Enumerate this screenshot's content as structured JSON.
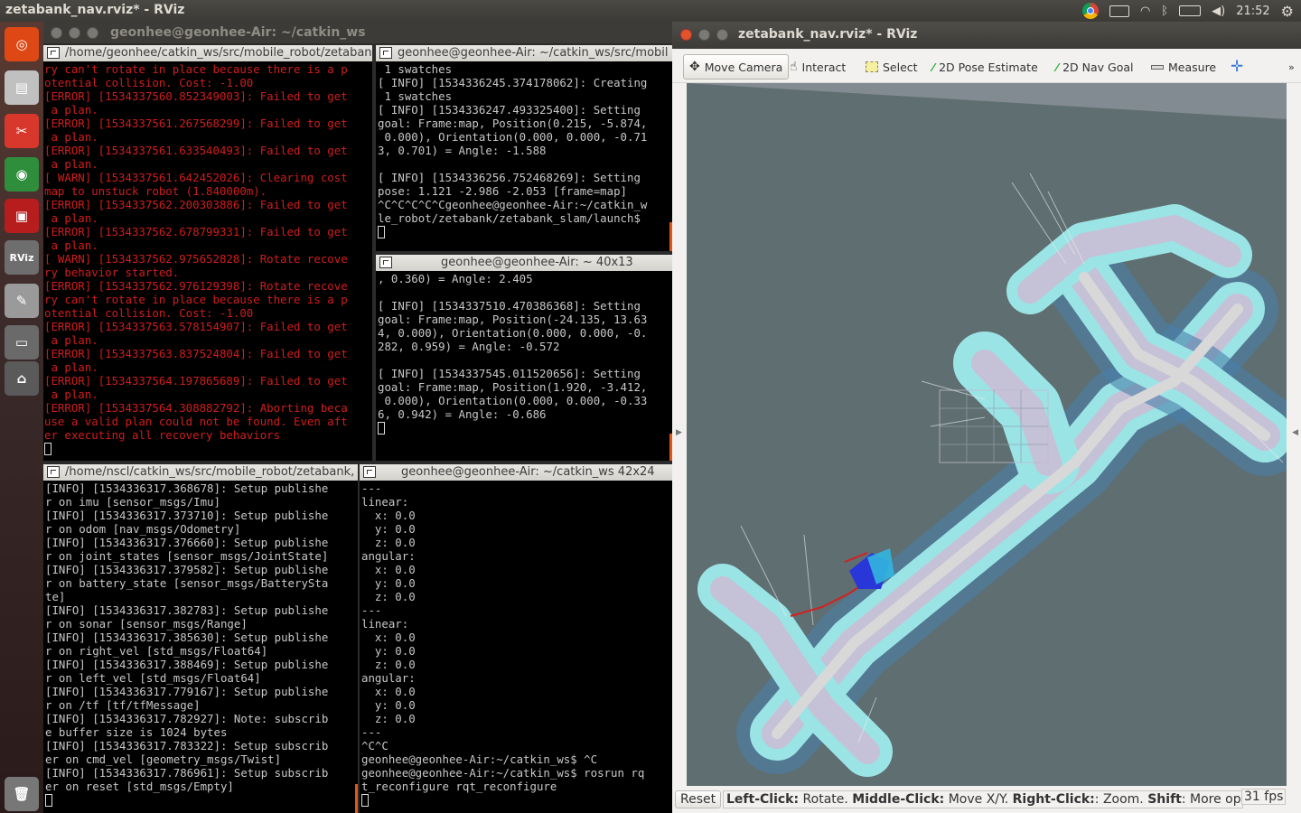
{
  "topbar": {
    "title": "zetabank_nav.rviz* - RViz",
    "clock": "21:52"
  },
  "launcher": {
    "items": [
      {
        "name": "ubuntu-dash-icon",
        "glyph": "◎",
        "bg": "#dd4814"
      },
      {
        "name": "files-icon",
        "glyph": "▤",
        "bg": "#c0c0c0"
      },
      {
        "name": "system-settings-icon",
        "glyph": "✂",
        "bg": "#d8382b"
      },
      {
        "name": "chrome-icon",
        "glyph": "◉",
        "bg": "#2f8e3c"
      },
      {
        "name": "terminal-icon",
        "glyph": "▣",
        "bg": "#b81d1d"
      },
      {
        "name": "rviz-icon",
        "glyph": "RViz",
        "bg": "#6e6e6e"
      },
      {
        "name": "text-editor-icon",
        "glyph": "✎",
        "bg": "#9a9a9a"
      },
      {
        "name": "disk-icon",
        "glyph": "▭",
        "bg": "#6a6a6a"
      },
      {
        "name": "usb-icon",
        "glyph": "⌂",
        "bg": "#5a5a5a"
      },
      {
        "name": "trash-icon",
        "glyph": "🗑",
        "bg": "#777"
      }
    ]
  },
  "main_window": {
    "title": "geonhee@geonhee-Air: ~/catkin_ws"
  },
  "terminals": {
    "t1": {
      "title": "/home/geonhee/catkin_ws/src/mobile_robot/zetabank",
      "lines": [
        "ry can't rotate in place because there is a p",
        "otential collision. Cost: -1.00",
        "[ERROR] [1534337560.852349003]: Failed to get",
        " a plan.",
        "[ERROR] [1534337561.267568299]: Failed to get",
        " a plan.",
        "[ERROR] [1534337561.633540493]: Failed to get",
        " a plan.",
        "[ WARN] [1534337561.642452026]: Clearing cost",
        "map to unstuck robot (1.840000m).",
        "[ERROR] [1534337562.200303886]: Failed to get",
        " a plan.",
        "[ERROR] [1534337562.678799331]: Failed to get",
        " a plan.",
        "[ WARN] [1534337562.975652828]: Rotate recove",
        "ry behavior started.",
        "[ERROR] [1534337562.976129398]: Rotate recove",
        "ry can't rotate in place because there is a p",
        "otential collision. Cost: -1.00",
        "[ERROR] [1534337563.578154907]: Failed to get",
        " a plan.",
        "[ERROR] [1534337563.837524804]: Failed to get",
        " a plan.",
        "[ERROR] [1534337564.197865689]: Failed to get",
        " a plan.",
        "[ERROR] [1534337564.308882792]: Aborting beca",
        "use a valid plan could not be found. Even aft",
        "er executing all recovery behaviors"
      ]
    },
    "t2": {
      "title": "geonhee@geonhee-Air: ~/catkin_ws/src/mobil",
      "lines": [
        " 1 swatches",
        "[ INFO] [1534336245.374178062]: Creating",
        " 1 swatches",
        "[ INFO] [1534336247.493325400]: Setting",
        "goal: Frame:map, Position(0.215, -5.874,",
        " 0.000), Orientation(0.000, 0.000, -0.71",
        "3, 0.701) = Angle: -1.588",
        "",
        "[ INFO] [1534336256.752468269]: Setting",
        "pose: 1.121 -2.986 -2.053 [frame=map]",
        "^C^C^C^C^Cgeonhee@geonhee-Air:~/catkin_w",
        "le_robot/zetabank/zetabank_slam/launch$"
      ]
    },
    "t3": {
      "title": "geonhee@geonhee-Air: ~ 40x13",
      "lines": [
        ", 0.360) = Angle: 2.405",
        "",
        "[ INFO] [1534337510.470386368]: Setting",
        "goal: Frame:map, Position(-24.135, 13.63",
        "4, 0.000), Orientation(0.000, 0.000, -0.",
        "282, 0.959) = Angle: -0.572",
        "",
        "[ INFO] [1534337545.011520656]: Setting",
        "goal: Frame:map, Position(1.920, -3.412,",
        " 0.000), Orientation(0.000, 0.000, -0.33",
        "6, 0.942) = Angle: -0.686"
      ]
    },
    "t4": {
      "title": "/home/nscl/catkin_ws/src/mobile_robot/zetabank,",
      "lines": [
        "[INFO] [1534336317.368678]: Setup publishe",
        "r on imu [sensor_msgs/Imu]",
        "[INFO] [1534336317.373710]: Setup publishe",
        "r on odom [nav_msgs/Odometry]",
        "[INFO] [1534336317.376660]: Setup publishe",
        "r on joint_states [sensor_msgs/JointState]",
        "[INFO] [1534336317.379582]: Setup publishe",
        "r on battery_state [sensor_msgs/BatterySta",
        "te]",
        "[INFO] [1534336317.382783]: Setup publishe",
        "r on sonar [sensor_msgs/Range]",
        "[INFO] [1534336317.385630]: Setup publishe",
        "r on right_vel [std_msgs/Float64]",
        "[INFO] [1534336317.388469]: Setup publishe",
        "r on left_vel [std_msgs/Float64]",
        "[INFO] [1534336317.779167]: Setup publishe",
        "r on /tf [tf/tfMessage]",
        "[INFO] [1534336317.782927]: Note: subscrib",
        "e buffer size is 1024 bytes",
        "[INFO] [1534336317.783322]: Setup subscrib",
        "er on cmd_vel [geometry_msgs/Twist]",
        "[INFO] [1534336317.786961]: Setup subscrib",
        "er on reset [std_msgs/Empty]"
      ]
    },
    "t5": {
      "title": "geonhee@geonhee-Air: ~/catkin_ws 42x24",
      "lines": [
        "---",
        "linear:",
        "  x: 0.0",
        "  y: 0.0",
        "  z: 0.0",
        "angular:",
        "  x: 0.0",
        "  y: 0.0",
        "  z: 0.0",
        "---",
        "linear:",
        "  x: 0.0",
        "  y: 0.0",
        "  z: 0.0",
        "angular:",
        "  x: 0.0",
        "  y: 0.0",
        "  z: 0.0",
        "---",
        "^C^C",
        "geonhee@geonhee-Air:~/catkin_ws$ ^C",
        "geonhee@geonhee-Air:~/catkin_ws$ rosrun rq",
        "t_reconfigure rqt_reconfigure"
      ]
    }
  },
  "rviz": {
    "title": "zetabank_nav.rviz* - RViz",
    "tools": {
      "move_camera": "Move Camera",
      "interact": "Interact",
      "select": "Select",
      "pose_estimate": "2D Pose Estimate",
      "nav_goal": "2D Nav Goal",
      "measure": "Measure"
    },
    "status": {
      "reset": "Reset",
      "left_b": "Left-Click:",
      "left_t": " Rotate. ",
      "mid_b": "Middle-Click:",
      "mid_t": " Move X/Y. ",
      "right_b": "Right-Click:",
      "right_t": ": Zoom. ",
      "shift_b": "Shift",
      "shift_t": ": More options",
      "fps": "31 fps"
    }
  }
}
